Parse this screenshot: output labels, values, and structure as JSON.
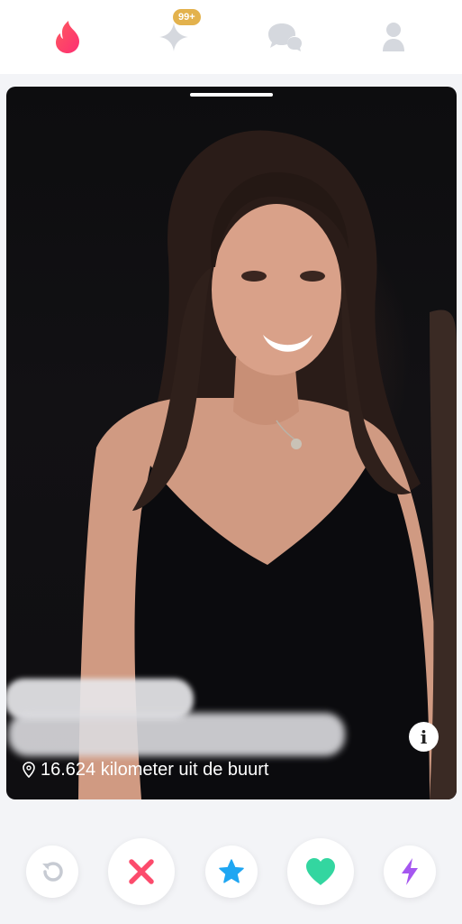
{
  "top_nav": {
    "items": [
      {
        "icon": "flame-icon",
        "active": true,
        "color": "#fd3f6b"
      },
      {
        "icon": "sparkle-icon",
        "badge": "99+",
        "badge_color": "#e3b24d",
        "color": "#d5d8de"
      },
      {
        "icon": "chat-bubbles-icon",
        "color": "#d5d8de"
      },
      {
        "icon": "profile-icon",
        "color": "#d5d8de"
      }
    ]
  },
  "card": {
    "photo_indicator_count": 1,
    "name_redacted": true,
    "bio_redacted": true,
    "distance_text": "16.624 kilometer uit de buurt",
    "info_label": "i"
  },
  "actions": [
    {
      "name": "rewind",
      "icon": "rewind-icon",
      "color": "#c7cbd3"
    },
    {
      "name": "nope",
      "icon": "close-icon",
      "color": "#fc4b6c"
    },
    {
      "name": "super-like",
      "icon": "star-icon",
      "color": "#1fa6f2"
    },
    {
      "name": "like",
      "icon": "heart-icon",
      "color": "#33d6a0"
    },
    {
      "name": "boost",
      "icon": "lightning-icon",
      "color": "#a557f0"
    }
  ]
}
